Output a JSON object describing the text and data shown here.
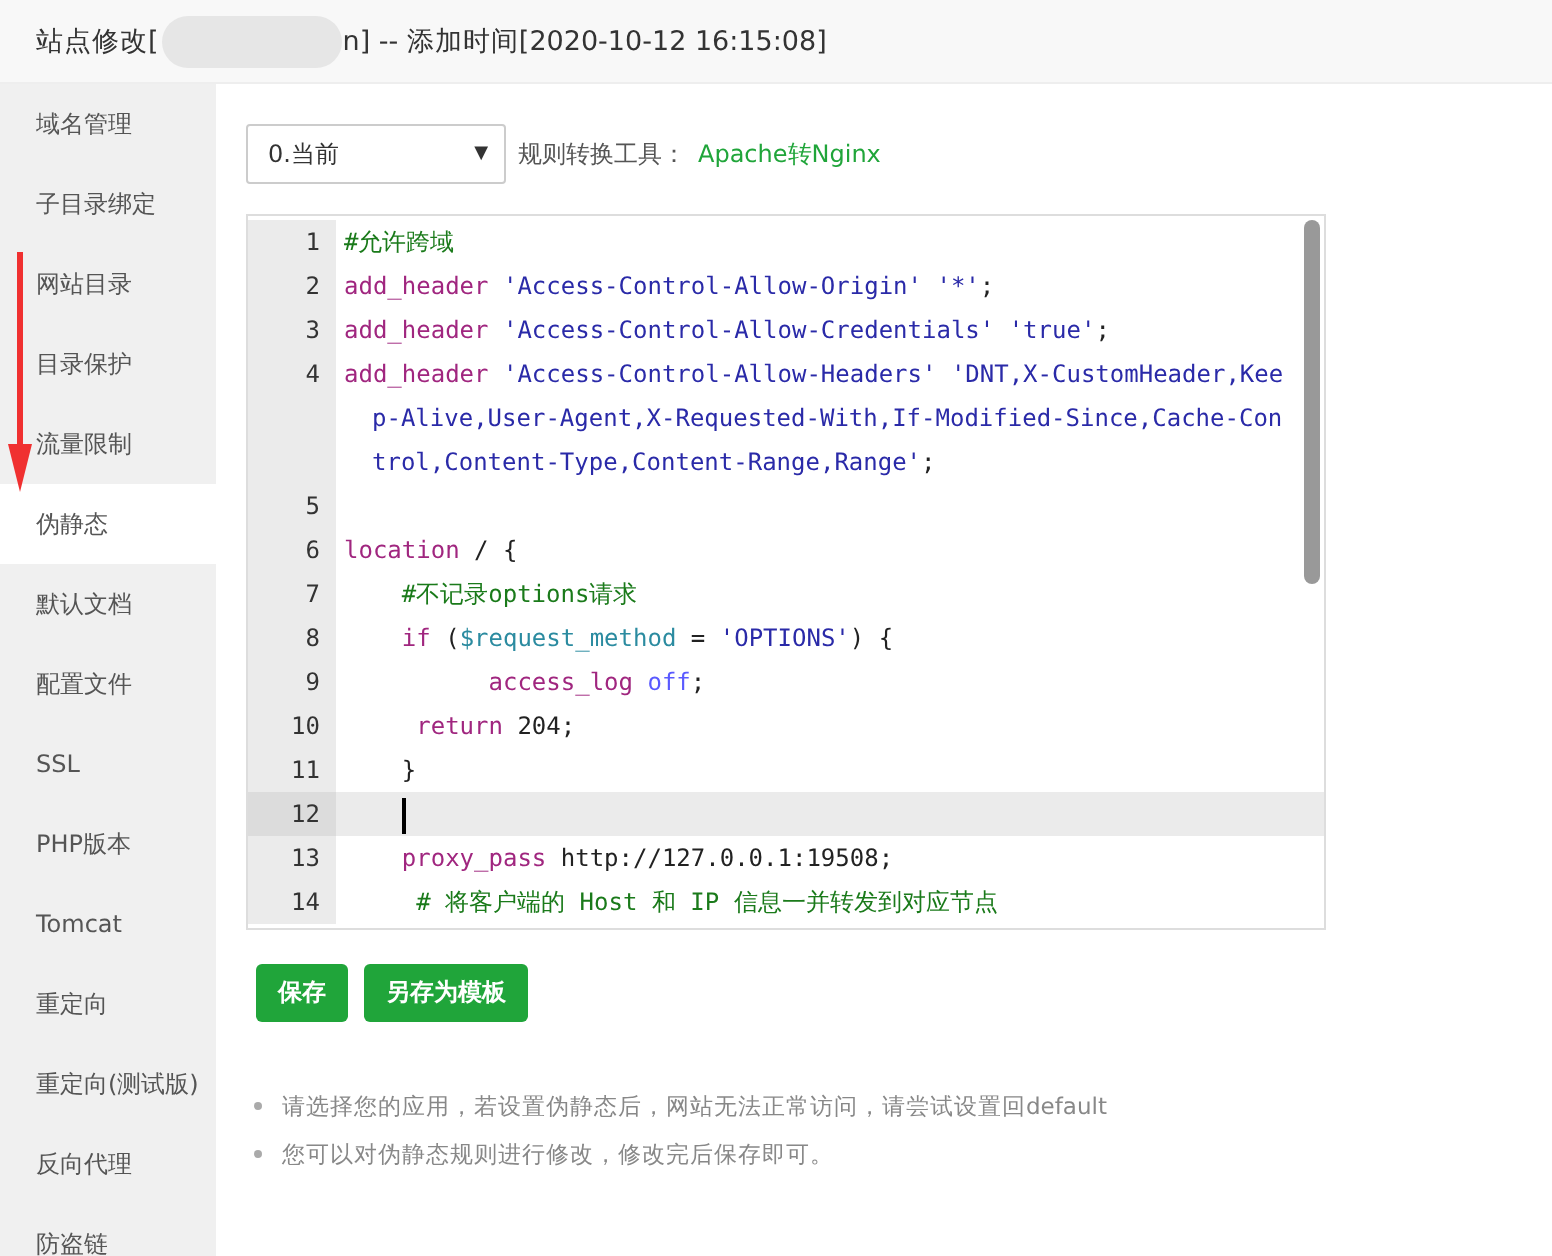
{
  "window": {
    "title_prefix": "站点修改[",
    "title_suffix": "n] -- 添加时间[2020-10-12 16:15:08]"
  },
  "sidebar": {
    "items": [
      {
        "label": "域名管理",
        "selected": false
      },
      {
        "label": "子目录绑定",
        "selected": false
      },
      {
        "label": "网站目录",
        "selected": false
      },
      {
        "label": "目录保护",
        "selected": false
      },
      {
        "label": "流量限制",
        "selected": false
      },
      {
        "label": "伪静态",
        "selected": true
      },
      {
        "label": "默认文档",
        "selected": false
      },
      {
        "label": "配置文件",
        "selected": false
      },
      {
        "label": "SSL",
        "selected": false
      },
      {
        "label": "PHP版本",
        "selected": false
      },
      {
        "label": "Tomcat",
        "selected": false
      },
      {
        "label": "重定向",
        "selected": false
      },
      {
        "label": "重定向(测试版)",
        "selected": false
      },
      {
        "label": "反向代理",
        "selected": false
      },
      {
        "label": "防盗链",
        "selected": false
      }
    ]
  },
  "toolbar": {
    "select_value": "0.当前",
    "select_caret": "▼",
    "tool_label": "规则转换工具：",
    "tool_link": "Apache转Nginx"
  },
  "editor": {
    "lines": [
      {
        "number": "1",
        "current": false,
        "tokens": [
          {
            "kind": "comment",
            "text": "#允许跨域"
          }
        ]
      },
      {
        "number": "2",
        "current": false,
        "tokens": [
          {
            "kind": "keyword",
            "text": "add_header"
          },
          {
            "kind": "string",
            "text": " 'Access-Control-Allow-Origin' '*'"
          },
          {
            "kind": "plain",
            "text": ";"
          }
        ]
      },
      {
        "number": "3",
        "current": false,
        "tokens": [
          {
            "kind": "keyword",
            "text": "add_header"
          },
          {
            "kind": "string",
            "text": " 'Access-Control-Allow-Credentials' 'true'"
          },
          {
            "kind": "plain",
            "text": ";"
          }
        ]
      },
      {
        "number": "4",
        "current": false,
        "tokens": [
          {
            "kind": "keyword",
            "text": "add_header"
          },
          {
            "kind": "string",
            "text": " 'Access-Control-Allow-Headers' 'DNT,X-CustomHeader,Keep-Alive,User-Agent,X-Requested-With,If-Modified-Since,Cache-Control,Content-Type,Content-Range,Range'"
          },
          {
            "kind": "plain",
            "text": ";"
          }
        ]
      },
      {
        "number": "5",
        "current": false
      },
      {
        "number": "6",
        "current": false,
        "tokens": [
          {
            "kind": "keyword",
            "text": "location"
          },
          {
            "kind": "plain",
            "text": " / {"
          }
        ]
      },
      {
        "number": "7",
        "current": false,
        "tokens": [
          {
            "kind": "comment",
            "text": "    #不记录options请求"
          }
        ]
      },
      {
        "number": "8",
        "current": false,
        "tokens": [
          {
            "kind": "keyword",
            "text": "    if"
          },
          {
            "kind": "plain",
            "text": " ("
          },
          {
            "kind": "variable",
            "text": "$request_method"
          },
          {
            "kind": "plain",
            "text": " = "
          },
          {
            "kind": "string",
            "text": "'OPTIONS'"
          },
          {
            "kind": "plain",
            "text": ") {"
          }
        ]
      },
      {
        "number": "9",
        "current": false,
        "tokens": [
          {
            "kind": "keyword",
            "text": "          access_log"
          },
          {
            "kind": "atom",
            "text": " off"
          },
          {
            "kind": "plain",
            "text": ";"
          }
        ]
      },
      {
        "number": "10",
        "current": false,
        "tokens": [
          {
            "kind": "keyword",
            "text": "     return"
          },
          {
            "kind": "plain",
            "text": " 204;"
          }
        ]
      },
      {
        "number": "11",
        "current": false,
        "tokens": [
          {
            "kind": "plain",
            "text": "    }"
          }
        ]
      },
      {
        "number": "12",
        "current": true
      },
      {
        "number": "13",
        "current": false,
        "tokens": [
          {
            "kind": "keyword",
            "text": "    proxy_pass"
          },
          {
            "kind": "plain",
            "text": " http://127.0.0.1:19508;"
          }
        ]
      },
      {
        "number": "14",
        "current": false,
        "tokens": [
          {
            "kind": "comment",
            "text": "     # 将客户端的 Host 和 IP 信息一并转发到对应节点"
          }
        ]
      }
    ]
  },
  "buttons": [
    "保存",
    "另存为模板"
  ],
  "notes": [
    "请选择您的应用，若设置伪静态后，网站无法正常访问，请尝试设置回default",
    "您可以对伪静态规则进行修改，修改完后保存即可。"
  ]
}
